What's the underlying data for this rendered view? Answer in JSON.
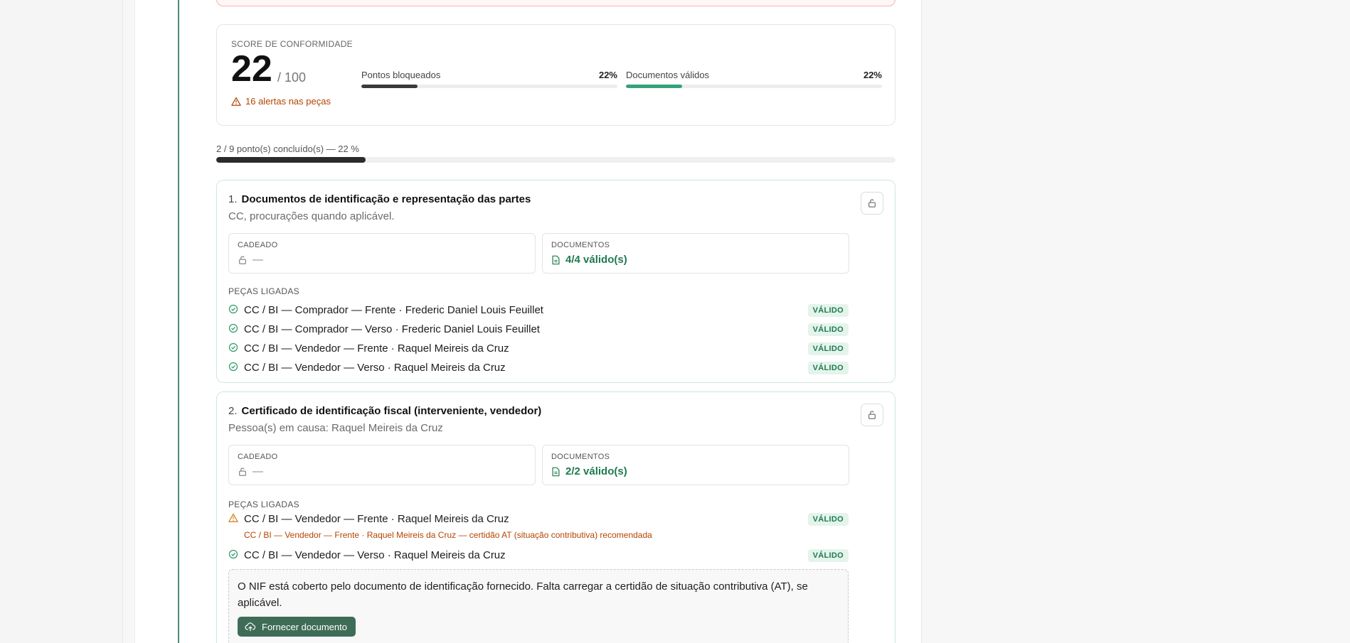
{
  "score": {
    "label": "SCORE DE CONFORMIDADE",
    "value": "22",
    "max": "/ 100",
    "alerts": "16 alertas nas peças",
    "meters": [
      {
        "label": "Pontos bloqueados",
        "pct": "22%",
        "fraction": 0.22,
        "color": "#3a3a3a"
      },
      {
        "label": "Documentos válidos",
        "pct": "22%",
        "fraction": 0.22,
        "color": "#35a37a"
      }
    ]
  },
  "progress": {
    "label": "2 / 9 ponto(s) concluído(s) — 22 %",
    "fraction": 0.22
  },
  "sections": [
    {
      "num": "1.",
      "title": "Documentos de identificação e representação das partes",
      "subtitle": "CC, procurações quando aplicável.",
      "lock_label": "CADEADO",
      "lock_value": "—",
      "docs_label": "DOCUMENTOS",
      "docs_value": "4/4 válido(s)",
      "pieces_label": "PEÇAS LIGADAS",
      "pieces": [
        {
          "text": "CC / BI — Comprador — Frente · Frederic Daniel Louis Feuillet",
          "badge": "VÁLIDO",
          "status": "ok"
        },
        {
          "text": "CC / BI — Comprador — Verso · Frederic Daniel Louis Feuillet",
          "badge": "VÁLIDO",
          "status": "ok"
        },
        {
          "text": "CC / BI — Vendedor — Frente · Raquel Meireis da Cruz",
          "badge": "VÁLIDO",
          "status": "ok"
        },
        {
          "text": "CC / BI — Vendedor — Verso · Raquel Meireis da Cruz",
          "badge": "VÁLIDO",
          "status": "ok"
        }
      ]
    },
    {
      "num": "2.",
      "title": "Certificado de identificação fiscal (interveniente, vendedor)",
      "subtitle": "Pessoa(s) em causa: Raquel Meireis da Cruz",
      "lock_label": "CADEADO",
      "lock_value": "—",
      "docs_label": "DOCUMENTOS",
      "docs_value": "2/2 válido(s)",
      "pieces_label": "PEÇAS LIGADAS",
      "pieces": [
        {
          "text": "CC / BI — Vendedor — Frente · Raquel Meireis da Cruz",
          "badge": "VÁLIDO",
          "status": "warn",
          "note": "CC / BI — Vendedor — Frente · Raquel Meireis da Cruz — certidão AT (situação contributiva) recomendada"
        },
        {
          "text": "CC / BI — Vendedor — Verso · Raquel Meireis da Cruz",
          "badge": "VÁLIDO",
          "status": "ok"
        }
      ],
      "note": "O NIF está coberto pelo documento de identificação fornecido. Falta carregar a certidão de situação contributiva (AT), se aplicável.",
      "button": "Fornecer documento"
    }
  ]
}
